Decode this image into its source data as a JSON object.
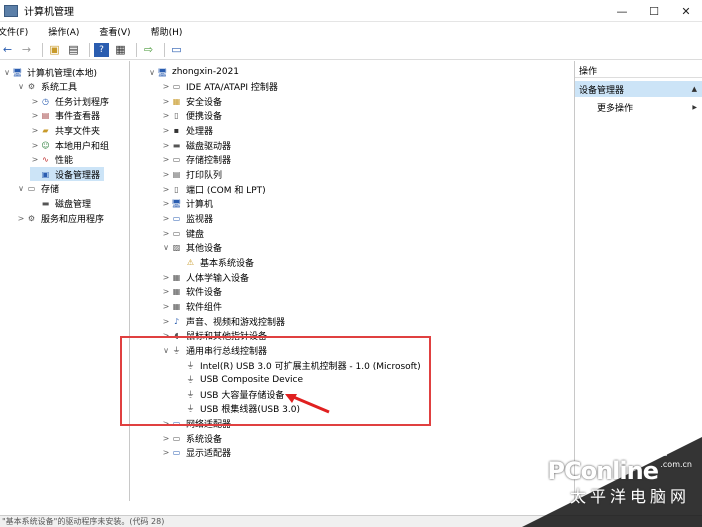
{
  "window": {
    "title": "计算机管理",
    "min": "—",
    "max": "☐",
    "close": "✕"
  },
  "menu": [
    "文件(F)",
    "操作(A)",
    "查看(V)",
    "帮助(H)"
  ],
  "left_tree": [
    {
      "label": "计算机管理(本地)",
      "indent": 0,
      "arrow": "∨",
      "icon": "computer-icon"
    },
    {
      "label": "系统工具",
      "indent": 1,
      "arrow": "∨",
      "icon": "tools-icon"
    },
    {
      "label": "任务计划程序",
      "indent": 2,
      "arrow": ">",
      "icon": "clock-icon"
    },
    {
      "label": "事件查看器",
      "indent": 2,
      "arrow": ">",
      "icon": "event-icon"
    },
    {
      "label": "共享文件夹",
      "indent": 2,
      "arrow": ">",
      "icon": "folder-icon"
    },
    {
      "label": "本地用户和组",
      "indent": 2,
      "arrow": ">",
      "icon": "users-icon"
    },
    {
      "label": "性能",
      "indent": 2,
      "arrow": ">",
      "icon": "performance-icon"
    },
    {
      "label": "设备管理器",
      "indent": 2,
      "arrow": "",
      "icon": "device-manager-icon",
      "selected": true
    },
    {
      "label": "存储",
      "indent": 1,
      "arrow": "∨",
      "icon": "storage-icon"
    },
    {
      "label": "磁盘管理",
      "indent": 2,
      "arrow": "",
      "icon": "disk-icon"
    },
    {
      "label": "服务和应用程序",
      "indent": 1,
      "arrow": ">",
      "icon": "services-icon"
    }
  ],
  "device_tree": [
    {
      "label": "zhongxin-2021",
      "indent": 0,
      "arrow": "∨",
      "icon": "computer-icon"
    },
    {
      "label": "IDE ATA/ATAPI 控制器",
      "indent": 1,
      "arrow": ">",
      "icon": "ide-icon"
    },
    {
      "label": "安全设备",
      "indent": 1,
      "arrow": ">",
      "icon": "security-icon"
    },
    {
      "label": "便携设备",
      "indent": 1,
      "arrow": ">",
      "icon": "portable-icon"
    },
    {
      "label": "处理器",
      "indent": 1,
      "arrow": ">",
      "icon": "cpu-icon"
    },
    {
      "label": "磁盘驱动器",
      "indent": 1,
      "arrow": ">",
      "icon": "disk-icon"
    },
    {
      "label": "存储控制器",
      "indent": 1,
      "arrow": ">",
      "icon": "storage-controller-icon"
    },
    {
      "label": "打印队列",
      "indent": 1,
      "arrow": ">",
      "icon": "printer-icon"
    },
    {
      "label": "端口 (COM 和 LPT)",
      "indent": 1,
      "arrow": ">",
      "icon": "port-icon"
    },
    {
      "label": "计算机",
      "indent": 1,
      "arrow": ">",
      "icon": "computer-icon"
    },
    {
      "label": "监视器",
      "indent": 1,
      "arrow": ">",
      "icon": "monitor-icon"
    },
    {
      "label": "键盘",
      "indent": 1,
      "arrow": ">",
      "icon": "keyboard-icon"
    },
    {
      "label": "其他设备",
      "indent": 1,
      "arrow": "∨",
      "icon": "other-device-icon"
    },
    {
      "label": "基本系统设备",
      "indent": 2,
      "arrow": "",
      "icon": "warning-device-icon"
    },
    {
      "label": "人体学输入设备",
      "indent": 1,
      "arrow": ">",
      "icon": "hid-icon"
    },
    {
      "label": "软件设备",
      "indent": 1,
      "arrow": ">",
      "icon": "software-device-icon"
    },
    {
      "label": "软件组件",
      "indent": 1,
      "arrow": ">",
      "icon": "software-component-icon"
    },
    {
      "label": "声音、视频和游戏控制器",
      "indent": 1,
      "arrow": ">",
      "icon": "sound-icon"
    },
    {
      "label": "鼠标和其他指针设备",
      "indent": 1,
      "arrow": ">",
      "icon": "mouse-icon"
    },
    {
      "label": "通用串行总线控制器",
      "indent": 1,
      "arrow": "∨",
      "icon": "usb-icon"
    },
    {
      "label": "Intel(R) USB 3.0 可扩展主机控制器 - 1.0 (Microsoft)",
      "indent": 2,
      "arrow": "",
      "icon": "usb-icon"
    },
    {
      "label": "USB Composite Device",
      "indent": 2,
      "arrow": "",
      "icon": "usb-icon"
    },
    {
      "label": "USB 大容量存储设备",
      "indent": 2,
      "arrow": "",
      "icon": "usb-icon"
    },
    {
      "label": "USB 根集线器(USB 3.0)",
      "indent": 2,
      "arrow": "",
      "icon": "usb-icon"
    },
    {
      "label": "网络适配器",
      "indent": 1,
      "arrow": ">",
      "icon": "network-icon"
    },
    {
      "label": "系统设备",
      "indent": 1,
      "arrow": ">",
      "icon": "system-device-icon"
    },
    {
      "label": "显示适配器",
      "indent": 1,
      "arrow": ">",
      "icon": "display-adapter-icon"
    }
  ],
  "actions": {
    "header": "操作",
    "section": "设备管理器",
    "more": "更多操作",
    "chevron_up": "▲",
    "chevron_right": "▶"
  },
  "status": "\"基本系统设备\"的驱动程序未安装。(代码 28)",
  "watermark": {
    "logo": "PConline",
    "cn": "太平洋电脑网",
    "domain": ".com.cn"
  }
}
